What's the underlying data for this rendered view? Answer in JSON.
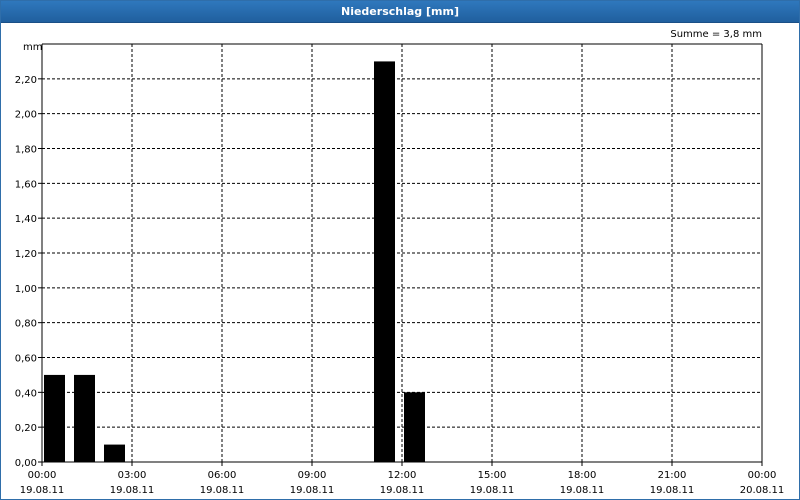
{
  "window": {
    "title": "Niederschlag [mm]"
  },
  "chart_data": {
    "type": "bar",
    "title": "Niederschlag [mm]",
    "ylabel": "mm",
    "annotation": "Summe = 3,8 mm",
    "ylim": [
      0,
      2.4
    ],
    "xlim_hours": [
      0,
      24
    ],
    "y_ticks": [
      "0,00",
      "0,20",
      "0,40",
      "0,60",
      "0,80",
      "1,00",
      "1,20",
      "1,40",
      "1,60",
      "1,80",
      "2,00",
      "2,20"
    ],
    "x_ticks": [
      {
        "time": "00:00",
        "date": "19.08.11"
      },
      {
        "time": "03:00",
        "date": "19.08.11"
      },
      {
        "time": "06:00",
        "date": "19.08.11"
      },
      {
        "time": "09:00",
        "date": "19.08.11"
      },
      {
        "time": "12:00",
        "date": "19.08.11"
      },
      {
        "time": "15:00",
        "date": "19.08.11"
      },
      {
        "time": "18:00",
        "date": "19.08.11"
      },
      {
        "time": "21:00",
        "date": "19.08.11"
      },
      {
        "time": "00:00",
        "date": "20.08.11"
      }
    ],
    "categories": [
      "00:00",
      "01:00",
      "02:00",
      "11:00",
      "12:00"
    ],
    "values": [
      0.5,
      0.5,
      0.1,
      2.3,
      0.4
    ],
    "bar_color": "#000000",
    "grid": true
  }
}
